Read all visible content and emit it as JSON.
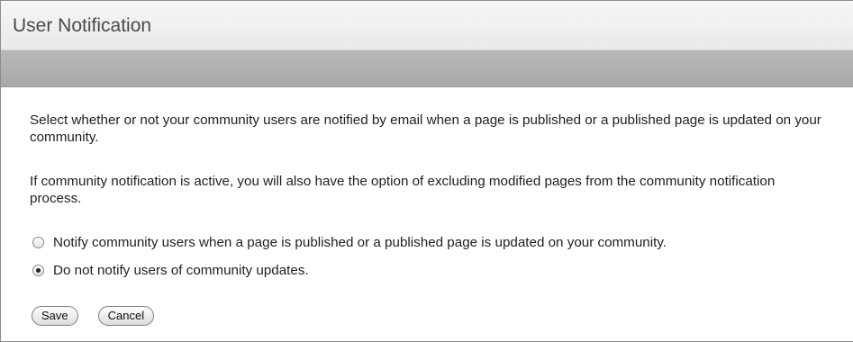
{
  "dialog": {
    "title": "User Notification"
  },
  "content": {
    "paragraph1": "Select whether or not your community users are notified by email when a page is published or a published page is updated on your community.",
    "paragraph2": "If community notification is active, you will also have the option of excluding modified pages from the community notification process."
  },
  "options": [
    {
      "label": "Notify community users when a page is published or a published page is updated on your community.",
      "selected": false
    },
    {
      "label": "Do not notify users of community updates.",
      "selected": true
    }
  ],
  "buttons": {
    "save_label": "Save",
    "cancel_label": "Cancel"
  }
}
